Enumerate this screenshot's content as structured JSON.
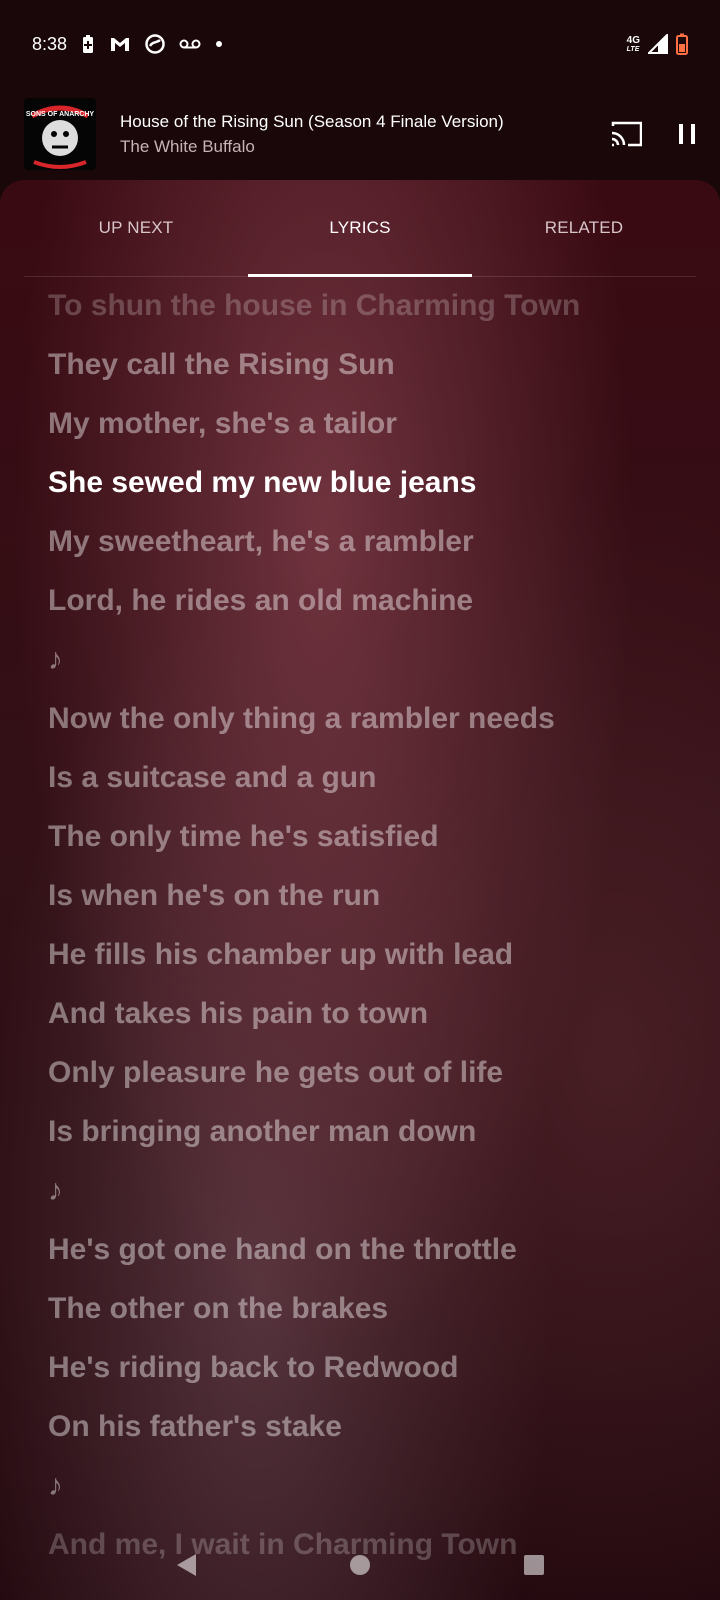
{
  "status_bar": {
    "time": "8:38",
    "left_icons": [
      "battery-saver-icon",
      "gmail-icon",
      "sync-icon",
      "voicemail-icon",
      "notification-dot-icon"
    ],
    "network_label": "4G",
    "network_sublabel": "LTE",
    "right_icons": [
      "signal-icon",
      "battery-icon"
    ],
    "battery_color": "#ff7043"
  },
  "player": {
    "title": "House of the Rising Sun (Season 4 Finale Version)",
    "artist": "The White Buffalo",
    "album_art_text": "SONS OF ANARCHY",
    "actions": [
      "cast-icon",
      "pause-icon"
    ]
  },
  "tabs": [
    {
      "label": "UP NEXT",
      "active": false
    },
    {
      "label": "LYRICS",
      "active": true
    },
    {
      "label": "RELATED",
      "active": false
    }
  ],
  "lyrics": [
    "To shun the house in Charming Town",
    "They call the Rising Sun",
    "My mother, she's a tailor",
    "She sewed my new blue jeans",
    "My sweetheart, he's a rambler",
    "Lord, he rides an old machine",
    "♪",
    "Now the only thing a rambler needs",
    "Is a suitcase and a gun",
    "The only time he's satisfied",
    "Is when he's on the run",
    "He fills his chamber up with lead",
    "And takes his pain to town",
    "Only pleasure he gets out of life",
    "Is bringing another man down",
    "♪",
    "He's got one hand on the throttle",
    "The other on the brakes",
    "He's riding back to Redwood",
    "On his father's stake",
    "♪",
    "And me, I wait in Charming Town"
  ],
  "active_lyric_index": 3,
  "nav_bar": {
    "buttons": [
      "back-icon",
      "home-icon",
      "recents-icon"
    ]
  }
}
